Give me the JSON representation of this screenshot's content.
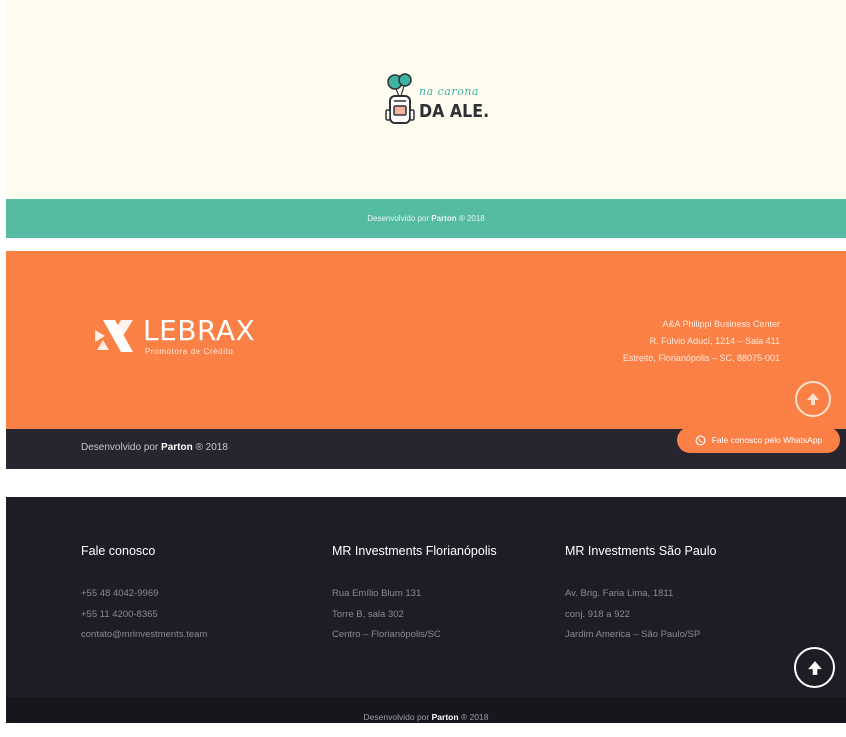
{
  "section_nacarona": {
    "logo_script": "na carona",
    "logo_brand": "DA ALE.",
    "credit_prefix": "Desenvolvido por",
    "credit_brand": "Parton",
    "credit_suffix": "® 2018",
    "colors": {
      "background": "#fffdf0",
      "bar": "#55bba3"
    }
  },
  "section_lebrax": {
    "logo_word": "LEBRAX",
    "logo_sub": "Promotora de Crédito",
    "address": [
      "A&A Philippi Business Center",
      "R. Fúlvio Aducí, 1214 – Sala 411",
      "Estreito, Florianópolis – SC, 88075-001"
    ],
    "credit_prefix": "Desenvolvido por",
    "credit_brand": "Parton",
    "credit_suffix": "® 2018",
    "whatsapp_label": "Fale conosco pelo WhatsApp",
    "icons": {
      "scroll_top": "arrow-up-icon",
      "whatsapp": "whatsapp-icon"
    },
    "colors": {
      "background": "#fa8046",
      "bottom": "#262530"
    }
  },
  "section_mr": {
    "columns": [
      {
        "title": "Fale conosco",
        "lines": [
          "+55 48 4042-9969",
          "+55 11 4200-8365",
          "contato@mrinvestments.team"
        ]
      },
      {
        "title": "MR Investments Florianópolis",
        "lines": [
          "Rua Emílio Blum 131",
          "Torre B, sala 302",
          "Centro – Florianópolis/SC"
        ]
      },
      {
        "title": "MR Investments São Paulo",
        "lines": [
          "Av. Brig. Faria Lima, 1811",
          "conj. 918 a 922",
          "Jardim America – São Paulo/SP"
        ]
      }
    ],
    "credit_prefix": "Desenvolvido por",
    "credit_brand": "Parton",
    "credit_suffix": "® 2018",
    "icons": {
      "scroll_top": "arrow-up-icon"
    },
    "colors": {
      "background": "#1f1c25",
      "bar": "#18161d"
    }
  }
}
